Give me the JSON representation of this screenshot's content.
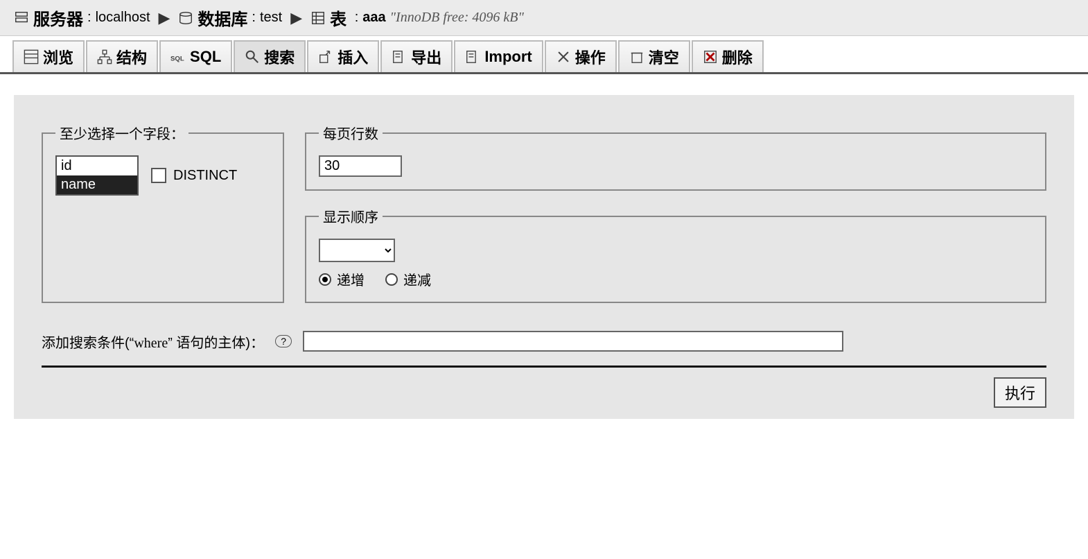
{
  "breadcrumb": {
    "server_label": "服务器",
    "server_value": "localhost",
    "database_label": "数据库",
    "database_value": "test",
    "table_label": "表",
    "table_value": "aaa",
    "table_comment": "\"InnoDB free: 4096 kB\""
  },
  "tabs": [
    {
      "label": "浏览",
      "icon": "browse-icon"
    },
    {
      "label": "结构",
      "icon": "structure-icon"
    },
    {
      "label": "SQL",
      "icon": "sql-icon"
    },
    {
      "label": "搜索",
      "icon": "search-icon",
      "active": true
    },
    {
      "label": "插入",
      "icon": "insert-icon"
    },
    {
      "label": "导出",
      "icon": "export-icon"
    },
    {
      "label": "Import",
      "icon": "import-icon"
    },
    {
      "label": "操作",
      "icon": "operations-icon"
    },
    {
      "label": "清空",
      "icon": "empty-icon"
    },
    {
      "label": "删除",
      "icon": "drop-icon"
    }
  ],
  "search": {
    "fields_legend": "至少选择一个字段：",
    "fields": [
      {
        "name": "id",
        "selected": false
      },
      {
        "name": "name",
        "selected": true
      }
    ],
    "distinct_label": "DISTINCT",
    "distinct_checked": false,
    "rows_legend": "每页行数",
    "rows_value": "30",
    "order_legend": "显示顺序",
    "order_selected": "",
    "order_options": [
      ""
    ],
    "order_asc_label": "递增",
    "order_desc_label": "递减",
    "order_direction": "asc",
    "where_label_pre": "添加搜索条件(",
    "where_label_quote_open": "“",
    "where_keyword": "where",
    "where_label_quote_close": "”",
    "where_label_post": " 语句的主体)：",
    "where_value": "",
    "execute_label": "执行"
  }
}
